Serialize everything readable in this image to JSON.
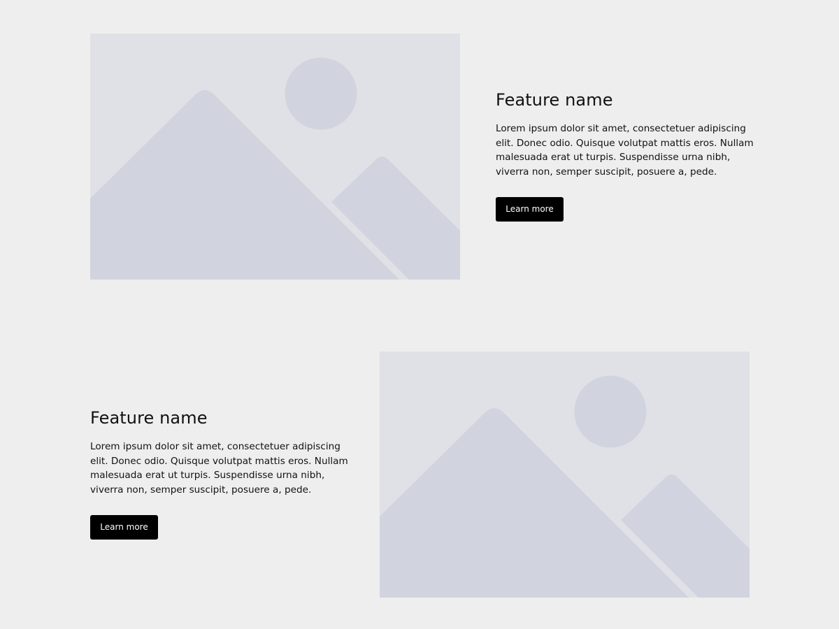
{
  "features": [
    {
      "title": "Feature name",
      "description": "Lorem ipsum dolor sit amet, consectetuer adipiscing elit. Donec odio. Quisque volutpat mattis eros. Nullam malesuada erat ut turpis. Suspendisse urna nibh, viverra non, semper suscipit, posuere a, pede.",
      "button_label": "Learn more",
      "image_icon": "image-placeholder-icon"
    },
    {
      "title": "Feature name",
      "description": "Lorem ipsum dolor sit amet, consectetuer adipiscing elit. Donec odio. Quisque volutpat mattis eros. Nullam malesuada erat ut turpis. Suspendisse urna nibh, viverra non, semper suscipit, posuere a, pede.",
      "button_label": "Learn more",
      "image_icon": "image-placeholder-icon"
    }
  ],
  "colors": {
    "page_background": "#eeeeee",
    "placeholder_background": "#e0e1e6",
    "placeholder_shapes": "#d1d3de",
    "button_background": "#000000",
    "button_text": "#ffffff",
    "text": "#111111"
  }
}
